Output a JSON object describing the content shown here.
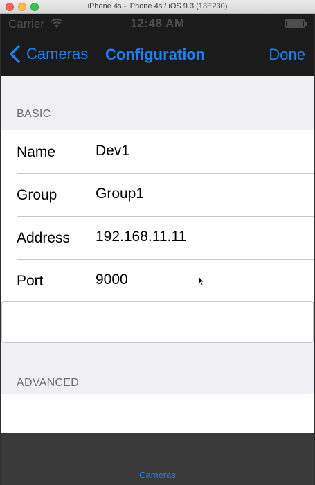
{
  "window": {
    "title": "iPhone 4s - iPhone 4s / iOS 9.3 (13E230)"
  },
  "status_bar": {
    "carrier": "Carrier",
    "time": "12:48 AM",
    "icons": [
      "wifi-icon",
      "battery-icon"
    ]
  },
  "nav": {
    "back_label": "Cameras",
    "title": "Configuration",
    "done_label": "Done",
    "accent_color": "#1a82f7"
  },
  "sections": {
    "basic": {
      "header": "BASIC",
      "rows": [
        {
          "label": "Name",
          "value": "Dev1"
        },
        {
          "label": "Group",
          "value": "Group1"
        },
        {
          "label": "Address",
          "value": "192.168.11.11"
        },
        {
          "label": "Port",
          "value": "9000"
        }
      ]
    },
    "advanced": {
      "header": "ADVANCED"
    }
  },
  "tab_bar": {
    "items": [
      {
        "label": "Cameras"
      }
    ]
  }
}
